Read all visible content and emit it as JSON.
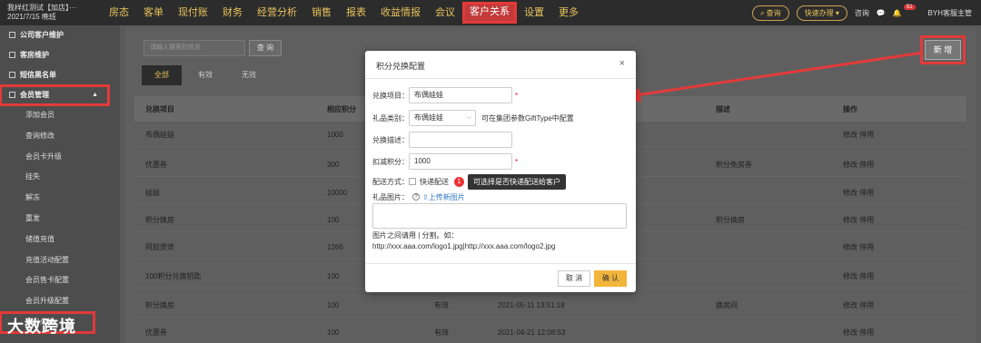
{
  "topbar": {
    "hotel_line1": "我样红测试【加店】···",
    "hotel_line2": "2021/7/15 晚班",
    "menu": [
      "房态",
      "客单",
      "现付账",
      "财务",
      "经营分析",
      "销售",
      "报表",
      "收益情报",
      "会议",
      "客户关系",
      "设置",
      "更多"
    ],
    "active_menu_index": 9,
    "search_label": "查询",
    "quick_label": "快速办理",
    "user_label": "咨询",
    "notification_count": "51",
    "account_label": "BYH客服主管"
  },
  "sidebar": {
    "groups": [
      "公司客户维护",
      "客房维护",
      "短信黑名单"
    ],
    "open_group": "会员管理",
    "sub_items": [
      "添加会员",
      "查询修改",
      "会员卡升级",
      "挂失",
      "解冻",
      "重发",
      "储值充值",
      "充值活动配置",
      "会员售卡配置",
      "会员升级配置",
      "积分兑换"
    ],
    "highlight_sub_index": 10
  },
  "main": {
    "search_placeholder": "请输入搜索的信息",
    "query_label": "查 询",
    "tabs": [
      "全部",
      "有效",
      "无效"
    ],
    "new_label": "新 增",
    "columns": [
      "兑换项目",
      "相应积分",
      "",
      "",
      "描述",
      "操作"
    ],
    "rows": [
      {
        "item": "布偶娃娃",
        "points": "1000",
        "status": "",
        "time": "",
        "desc": "",
        "ops": "修改  停用"
      },
      {
        "item": "优惠券",
        "points": "300",
        "status": "",
        "time": "",
        "desc": "积分免房券",
        "ops": "修改  停用"
      },
      {
        "item": "娃娃",
        "points": "10000",
        "status": "",
        "time": "",
        "desc": "",
        "ops": "修改  停用"
      },
      {
        "item": "积分换房",
        "points": "100",
        "status": "",
        "time": "",
        "desc": "积分换房",
        "ops": "修改  停用"
      },
      {
        "item": "阿胶煲煲",
        "points": "1266",
        "status": "",
        "time": "",
        "desc": "",
        "ops": "修改  停用"
      },
      {
        "item": "100积分兑换钥匙",
        "points": "100",
        "status": "",
        "time": "",
        "desc": "",
        "ops": "修改  停用"
      },
      {
        "item": "积分换房",
        "points": "100",
        "status": "有效",
        "time": "2021-05-11 13:51:18",
        "desc": "换房间",
        "ops": "修改  停用"
      },
      {
        "item": "优惠券",
        "points": "100",
        "status": "有效",
        "time": "2021-04-21 12:08:53",
        "desc": "",
        "ops": "修改  停用"
      }
    ]
  },
  "modal": {
    "title": "积分兑换配置",
    "close": "×",
    "item_label": "兑换项目：",
    "item_value": "布偶娃娃",
    "type_label": "礼品类别：",
    "type_value": "布偶娃娃",
    "type_hint": "可在集团参数GiftType中配置",
    "desc_label": "兑换描述：",
    "desc_value": "",
    "points_label": "扣减积分：",
    "points_value": "1000",
    "delivery_label": "配送方式：",
    "delivery_option": "快递配送",
    "tooltip_number": "1",
    "tooltip_text": "可选择是否快递配送给客户",
    "image_label": "礼品图片：",
    "upload_label": "上传新图片",
    "note": "图片之间请用 | 分割。如：  http://xxx.aaa.com/logo1.jpg|http://xxx.aaa.com/logo2.jpg",
    "cancel_label": "取 消",
    "ok_label": "确 认"
  },
  "watermark": "大数跨境",
  "colors": {
    "accent": "#e8c25a",
    "highlight": "#e43a3a",
    "ok_button": "#f2b53c"
  }
}
